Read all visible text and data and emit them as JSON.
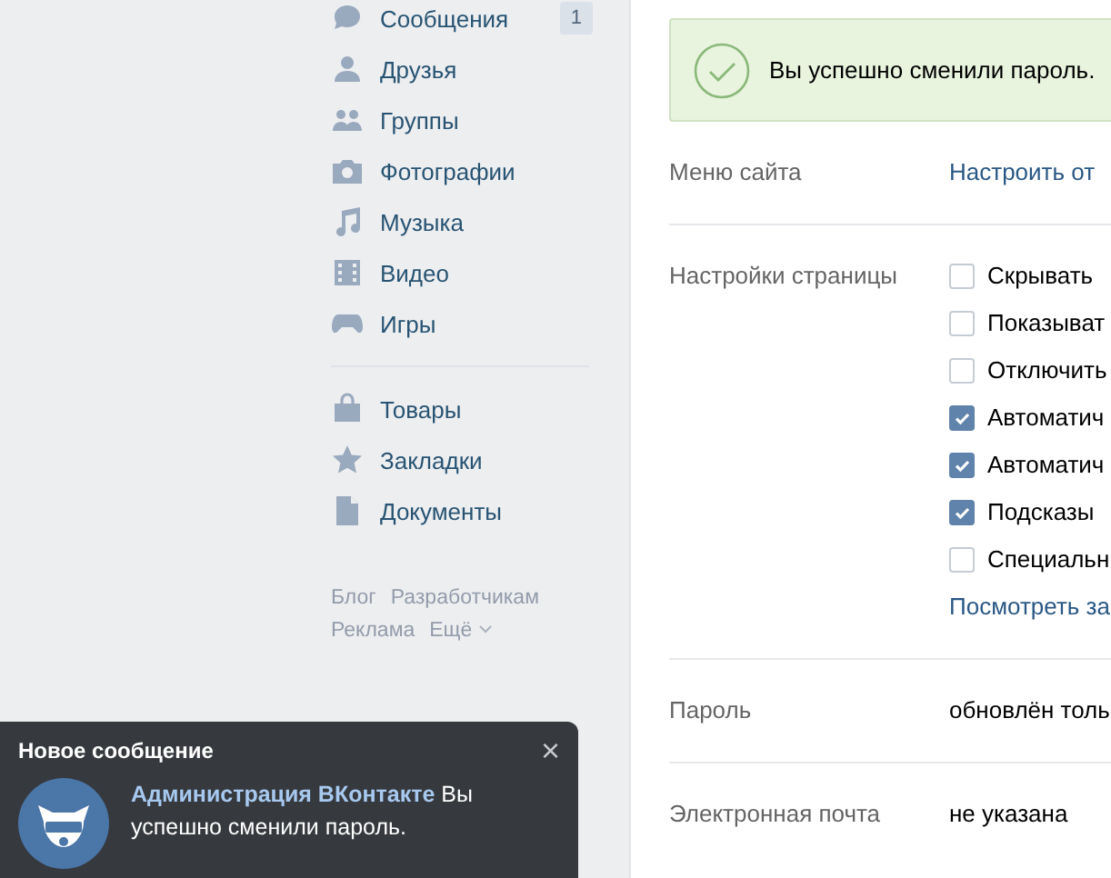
{
  "sidebar": {
    "sections": [
      {
        "items": [
          {
            "label": "Сообщения",
            "badge": "1"
          },
          {
            "label": "Друзья"
          },
          {
            "label": "Группы"
          },
          {
            "label": "Фотографии"
          },
          {
            "label": "Музыка"
          },
          {
            "label": "Видео"
          },
          {
            "label": "Игры"
          }
        ]
      },
      {
        "items": [
          {
            "label": "Товары"
          },
          {
            "label": "Закладки"
          },
          {
            "label": "Документы"
          }
        ]
      }
    ],
    "footer_rows": [
      [
        {
          "label": "Блог"
        },
        {
          "label": "Разработчикам"
        }
      ],
      [
        {
          "label": "Реклама"
        },
        {
          "label": "Ещё",
          "dropdown": true
        }
      ]
    ]
  },
  "alert": {
    "text": "Вы успешно сменили пароль."
  },
  "settings": [
    {
      "label": "Меню сайта",
      "kind": "link",
      "value": "Настроить от"
    },
    {
      "label": "Настройки страницы",
      "kind": "checkboxes",
      "options": [
        {
          "label": "Скрывать",
          "checked": false
        },
        {
          "label": "Показыват",
          "checked": false
        },
        {
          "label": "Отключить",
          "checked": false
        },
        {
          "label": "Автоматич",
          "checked": true
        },
        {
          "label": "Автоматич",
          "checked": true
        },
        {
          "label": "Подсказы",
          "checked": true
        },
        {
          "label": "Специальн",
          "checked": false
        }
      ],
      "link": "Посмотреть за"
    },
    {
      "label": "Пароль",
      "kind": "text",
      "value": "обновлён толь"
    },
    {
      "label": "Электронная почта",
      "kind": "text",
      "value": "не указана"
    }
  ],
  "notification": {
    "title": "Новое сообщение",
    "sender": "Администрация ВКонтакте",
    "text": "Вы успешно сменили пароль.",
    "close": "×"
  }
}
